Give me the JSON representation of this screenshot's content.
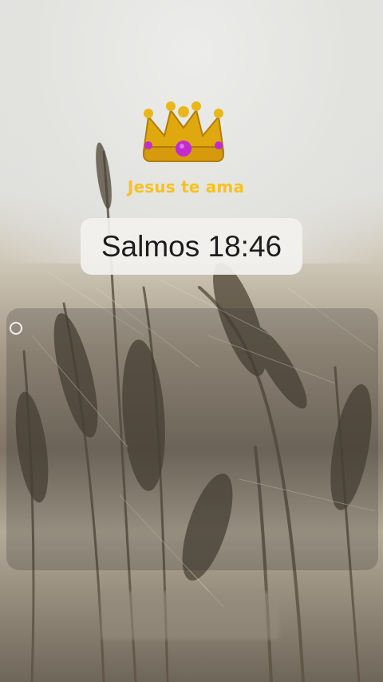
{
  "header": {
    "badge_icon": "crown-icon",
    "title": "Jesus te ama",
    "title_color": "#f6c21d"
  },
  "verse": {
    "reference": "Salmos 18:46"
  },
  "panel": {
    "selector_icon": "radio-circle-icon"
  },
  "background": {
    "theme": "wheat-field",
    "tone": "sepia"
  }
}
